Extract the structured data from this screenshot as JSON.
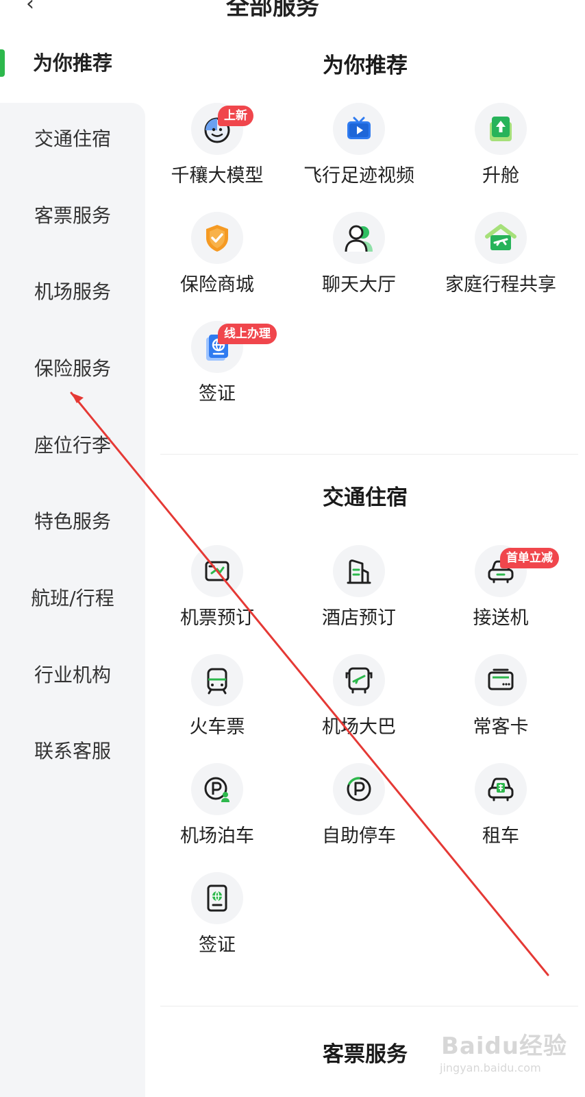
{
  "header": {
    "back_icon": "chevron-left-icon",
    "title_fragment": "全部服务"
  },
  "sidebar": {
    "items": [
      {
        "label": "为你推荐",
        "active": true
      },
      {
        "label": "交通住宿",
        "active": false
      },
      {
        "label": "客票服务",
        "active": false
      },
      {
        "label": "机场服务",
        "active": false
      },
      {
        "label": "保险服务",
        "active": false
      },
      {
        "label": "座位行李",
        "active": false
      },
      {
        "label": "特色服务",
        "active": false
      },
      {
        "label": "航班/行程",
        "active": false
      },
      {
        "label": "行业机构",
        "active": false
      },
      {
        "label": "联系客服",
        "active": false
      }
    ],
    "accent_color": "#2db84c"
  },
  "sections": [
    {
      "title": "为你推荐",
      "tiles": [
        {
          "label": "千穰大模型",
          "icon": "smiling-face-icon",
          "badge": "上新"
        },
        {
          "label": "飞行足迹视频",
          "icon": "tv-play-icon",
          "badge": ""
        },
        {
          "label": "升舱",
          "icon": "upgrade-arrow-icon",
          "badge": ""
        },
        {
          "label": "保险商城",
          "icon": "shield-check-icon",
          "badge": ""
        },
        {
          "label": "聊天大厅",
          "icon": "chat-users-icon",
          "badge": ""
        },
        {
          "label": "家庭行程共享",
          "icon": "home-plane-icon",
          "badge": ""
        },
        {
          "label": "签证",
          "icon": "globe-passport-icon",
          "badge": "线上办理"
        }
      ]
    },
    {
      "title": "交通住宿",
      "tiles": [
        {
          "label": "机票预订",
          "icon": "ticket-icon",
          "badge": ""
        },
        {
          "label": "酒店预订",
          "icon": "hotel-building-icon",
          "badge": ""
        },
        {
          "label": "接送机",
          "icon": "car-icon",
          "badge": "首单立减"
        },
        {
          "label": "火车票",
          "icon": "train-icon",
          "badge": ""
        },
        {
          "label": "机场大巴",
          "icon": "bus-icon",
          "badge": ""
        },
        {
          "label": "常客卡",
          "icon": "member-card-icon",
          "badge": ""
        },
        {
          "label": "机场泊车",
          "icon": "parking-person-icon",
          "badge": ""
        },
        {
          "label": "自助停车",
          "icon": "parking-icon",
          "badge": ""
        },
        {
          "label": "租车",
          "icon": "rental-car-icon",
          "badge": ""
        },
        {
          "label": "签证",
          "icon": "passport-icon",
          "badge": ""
        }
      ]
    },
    {
      "title": "客票服务",
      "tiles": []
    }
  ],
  "colors": {
    "badge": "#f0464c",
    "green": "#2db84c",
    "blue": "#2f7bf0",
    "orange": "#f59a23",
    "annotation_arrow": "#e53935"
  },
  "watermark": {
    "logo": "Baidu经验",
    "url": "jingyan.baidu.com"
  }
}
